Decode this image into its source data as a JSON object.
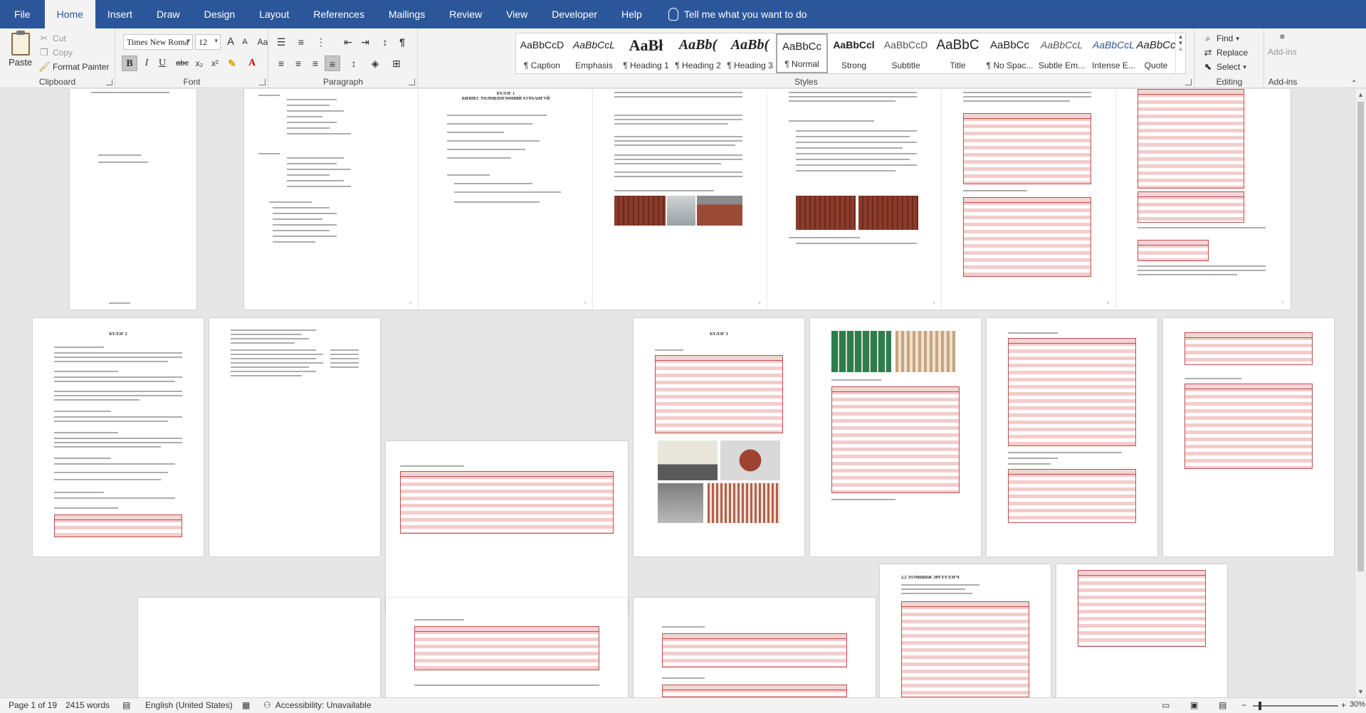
{
  "menu": {
    "tabs": [
      "File",
      "Home",
      "Insert",
      "Draw",
      "Design",
      "Layout",
      "References",
      "Mailings",
      "Review",
      "View",
      "Developer",
      "Help"
    ],
    "active": "Home",
    "tell_me": "Tell me what you want to do"
  },
  "clipboard": {
    "paste": "Paste",
    "cut": "Cut",
    "copy": "Copy",
    "format_painter": "Format Painter",
    "label": "Clipboard"
  },
  "font": {
    "name": "Times New Roma",
    "size": "12",
    "label": "Font",
    "bold": "B",
    "italic": "I",
    "underline": "U",
    "strike": "abc",
    "subscript": "x₂",
    "superscript": "x²",
    "grow": "A",
    "shrink": "A",
    "case": "Aa"
  },
  "paragraph": {
    "label": "Paragraph"
  },
  "styles": {
    "label": "Styles",
    "items": [
      {
        "preview": "AaBbCcD",
        "name": "¶ Caption"
      },
      {
        "preview": "AaBbCcL",
        "name": "Emphasis"
      },
      {
        "preview": "AaBł",
        "name": "¶ Heading 1"
      },
      {
        "preview": "AaBb(",
        "name": "¶ Heading 2"
      },
      {
        "preview": "AaBb(",
        "name": "¶ Heading 3"
      },
      {
        "preview": "AaBbCc",
        "name": "¶ Normal"
      },
      {
        "preview": "AaBbCcl",
        "name": "Strong"
      },
      {
        "preview": "AaBbCcD",
        "name": "Subtitle"
      },
      {
        "preview": "AaBbC",
        "name": "Title"
      },
      {
        "preview": "AaBbCc",
        "name": "¶ No Spac..."
      },
      {
        "preview": "AaBbCcL",
        "name": "Subtle Em..."
      },
      {
        "preview": "AaBbCcL",
        "name": "Intense E..."
      },
      {
        "preview": "AaBbCc",
        "name": "Quote"
      }
    ],
    "selected_index": 5
  },
  "editing": {
    "label": "Editing",
    "find": "Find",
    "replace": "Replace",
    "select": "Select"
  },
  "addins": {
    "button": "Add-ins",
    "label": "Add-ins"
  },
  "status": {
    "page": "Page 1 of 19",
    "words": "2415 words",
    "language": "English (United States)",
    "accessibility": "Accessibility: Unavailable",
    "zoom": "30%"
  },
  "doc": {
    "page_titles": [
      "БҮЛЭГ 1",
      "БИЗНЕС ТӨЛӨВЛӨГӨӨНИЙ ХУРААНГУЙ",
      "БҮЛЭГ 2",
      "БҮЛЭГ 3",
      "2.2 ЭЗЭМШИЖ ЭРГҮҮЛЭГЧ"
    ],
    "footer_pages": [
      "2",
      "3",
      "4",
      "5",
      "6",
      "7"
    ]
  },
  "colors": {
    "ribbon_blue": "#2b579a",
    "table_red": "#c0504d",
    "table_fill": "#f3cccc"
  }
}
